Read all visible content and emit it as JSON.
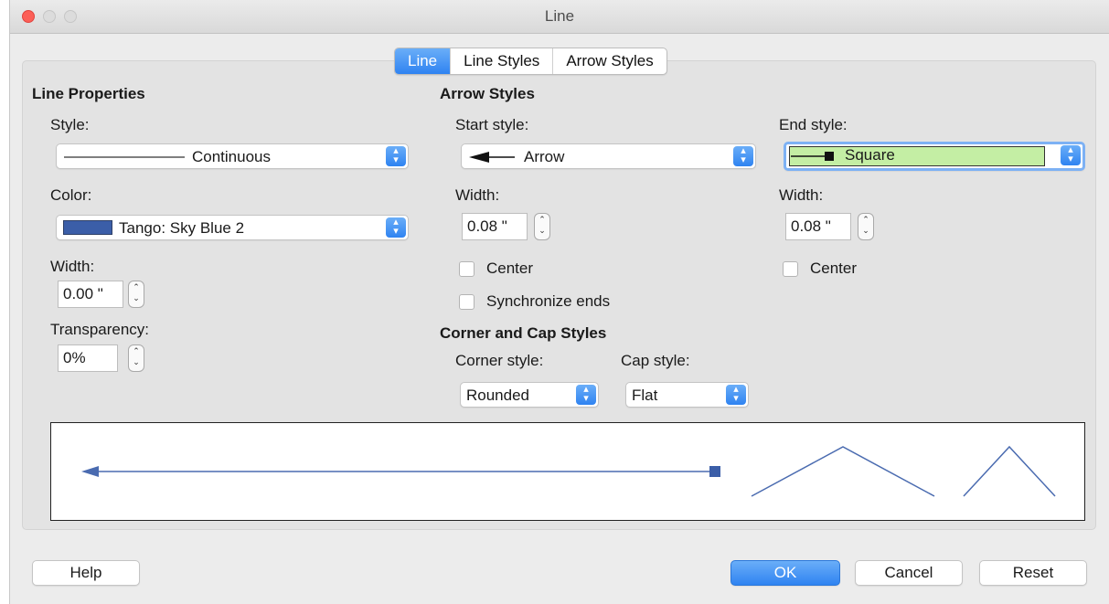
{
  "window": {
    "title": "Line"
  },
  "tabs": [
    {
      "label": "Line",
      "active": true
    },
    {
      "label": "Line Styles",
      "active": false
    },
    {
      "label": "Arrow Styles",
      "active": false
    }
  ],
  "line_properties": {
    "heading": "Line Properties",
    "style_label": "Style:",
    "style_value": "Continuous",
    "color_label": "Color:",
    "color_value": "Tango: Sky Blue 2",
    "color_swatch": "#3b5ea8",
    "width_label": "Width:",
    "width_value": "0.00 \"",
    "transparency_label": "Transparency:",
    "transparency_value": "0%"
  },
  "arrow_styles": {
    "heading": "Arrow Styles",
    "start_label": "Start style:",
    "start_value": "Arrow",
    "end_label": "End style:",
    "end_value": "Square",
    "start_width_label": "Width:",
    "start_width_value": "0.08 \"",
    "end_width_label": "Width:",
    "end_width_value": "0.08 \"",
    "start_center_label": "Center",
    "end_center_label": "Center",
    "sync_label": "Synchronize ends"
  },
  "corner_cap": {
    "heading": "Corner and Cap Styles",
    "corner_label": "Corner style:",
    "corner_value": "Rounded",
    "cap_label": "Cap style:",
    "cap_value": "Flat"
  },
  "buttons": {
    "help": "Help",
    "ok": "OK",
    "cancel": "Cancel",
    "reset": "Reset"
  },
  "colors": {
    "accent": "#2f83f1",
    "line_preview": "#4a6bb0",
    "end_style_highlight": "#c4eea4"
  }
}
